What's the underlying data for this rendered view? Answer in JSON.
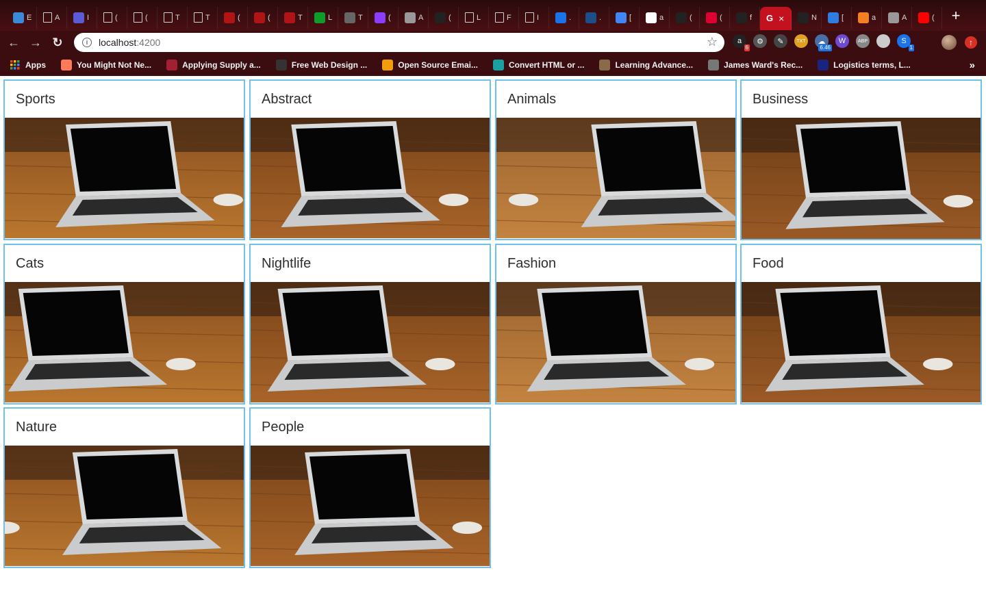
{
  "browser": {
    "tabs": [
      {
        "icon": "hexagon-icon",
        "letter": "E"
      },
      {
        "icon": "document-icon",
        "letter": "A"
      },
      {
        "icon": "circle-app-icon",
        "letter": "I"
      },
      {
        "icon": "document-icon",
        "letter": "("
      },
      {
        "icon": "document-icon",
        "letter": "("
      },
      {
        "icon": "document-icon",
        "letter": "T"
      },
      {
        "icon": "document-icon",
        "letter": "T"
      },
      {
        "icon": "braces-icon",
        "letter": "("
      },
      {
        "icon": "braces-icon",
        "letter": "("
      },
      {
        "icon": "braces-icon",
        "letter": "T"
      },
      {
        "icon": "ide-icon",
        "letter": "L"
      },
      {
        "icon": "dice-icon",
        "letter": "T"
      },
      {
        "icon": "check-circle-icon",
        "letter": "("
      },
      {
        "icon": "portrait-icon",
        "letter": "A"
      },
      {
        "icon": "github-icon",
        "letter": "("
      },
      {
        "icon": "document-icon",
        "letter": "L"
      },
      {
        "icon": "document-icon",
        "letter": "F"
      },
      {
        "icon": "document-icon",
        "letter": "I"
      },
      {
        "icon": "todo-check-icon",
        "letter": "."
      },
      {
        "icon": "globe-icon",
        "letter": "."
      },
      {
        "icon": "google-docs-icon",
        "letter": "["
      },
      {
        "icon": "google-icon",
        "letter": "a"
      },
      {
        "icon": "github-icon",
        "letter": "("
      },
      {
        "icon": "angular-icon",
        "letter": "("
      },
      {
        "icon": "github-icon",
        "letter": "f"
      }
    ],
    "active_tab": {
      "letter": "G",
      "close": "×"
    },
    "tabs_after": [
      {
        "icon": "github-icon",
        "letter": "N"
      },
      {
        "icon": "lightning-icon",
        "letter": "["
      },
      {
        "icon": "stackoverflow-icon",
        "letter": "a"
      },
      {
        "icon": "pen-icon",
        "letter": "A"
      },
      {
        "icon": "youtube-icon",
        "letter": "("
      }
    ],
    "new_tab": "+",
    "url": {
      "host": "localhost",
      "port": ":4200"
    },
    "extensions": [
      {
        "name": "amazon-icon",
        "label": "a",
        "badge": "6",
        "color": "#222222"
      },
      {
        "name": "gear-extension-icon",
        "label": "⚙",
        "badge": "",
        "color": "#555555"
      },
      {
        "name": "pen-extension-icon",
        "label": "✎",
        "badge": "",
        "color": "#444444"
      },
      {
        "name": "text-extension-icon",
        "label": "TXT",
        "badge": "",
        "color": "#e0a020"
      },
      {
        "name": "weather-extension-icon",
        "label": "☁",
        "badge": "6.46",
        "color": "#4a6fa5"
      },
      {
        "name": "wappalyzer-icon",
        "label": "W",
        "badge": "",
        "color": "#6c4bd1"
      },
      {
        "name": "adblock-icon",
        "label": "ABP",
        "badge": "",
        "color": "#888888"
      },
      {
        "name": "circle-extension-icon",
        "label": "",
        "badge": "",
        "color": "#cccccc"
      },
      {
        "name": "blue-extension-icon",
        "label": "S",
        "badge": "1",
        "color": "#1a73e8"
      }
    ],
    "bookmarks": [
      {
        "icon": "apps-grid-icon",
        "label": "Apps",
        "color": "#4285f4"
      },
      {
        "icon": "hubspot-icon",
        "label": "You Might Not Ne...",
        "color": "#ff7a59"
      },
      {
        "icon": "mit-icon",
        "label": "Applying Supply a...",
        "color": "#a31f34"
      },
      {
        "icon": "web-design-icon",
        "label": "Free Web Design ...",
        "color": "#333333"
      },
      {
        "icon": "email-icon",
        "label": "Open Source Emai...",
        "color": "#f29d0a"
      },
      {
        "icon": "convert-icon",
        "label": "Convert HTML or ...",
        "color": "#1aa1a1"
      },
      {
        "icon": "portrait-icon",
        "label": "Learning Advance...",
        "color": "#8a6a4a"
      },
      {
        "icon": "portrait-icon",
        "label": "James Ward's Rec...",
        "color": "#777777"
      },
      {
        "icon": "l-logo-icon",
        "label": "Logistics terms, L...",
        "color": "#1a237e"
      }
    ],
    "bookmarks_more": "»"
  },
  "categories": [
    {
      "title": "Sports"
    },
    {
      "title": "Abstract"
    },
    {
      "title": "Animals"
    },
    {
      "title": "Business"
    },
    {
      "title": "Cats"
    },
    {
      "title": "Nightlife"
    },
    {
      "title": "Fashion"
    },
    {
      "title": "Food"
    },
    {
      "title": "Nature"
    },
    {
      "title": "People"
    }
  ],
  "colors": {
    "chrome_dark": "#3b0d10",
    "active_tab": "#c3111f",
    "card_border": "#6fc1ec"
  }
}
